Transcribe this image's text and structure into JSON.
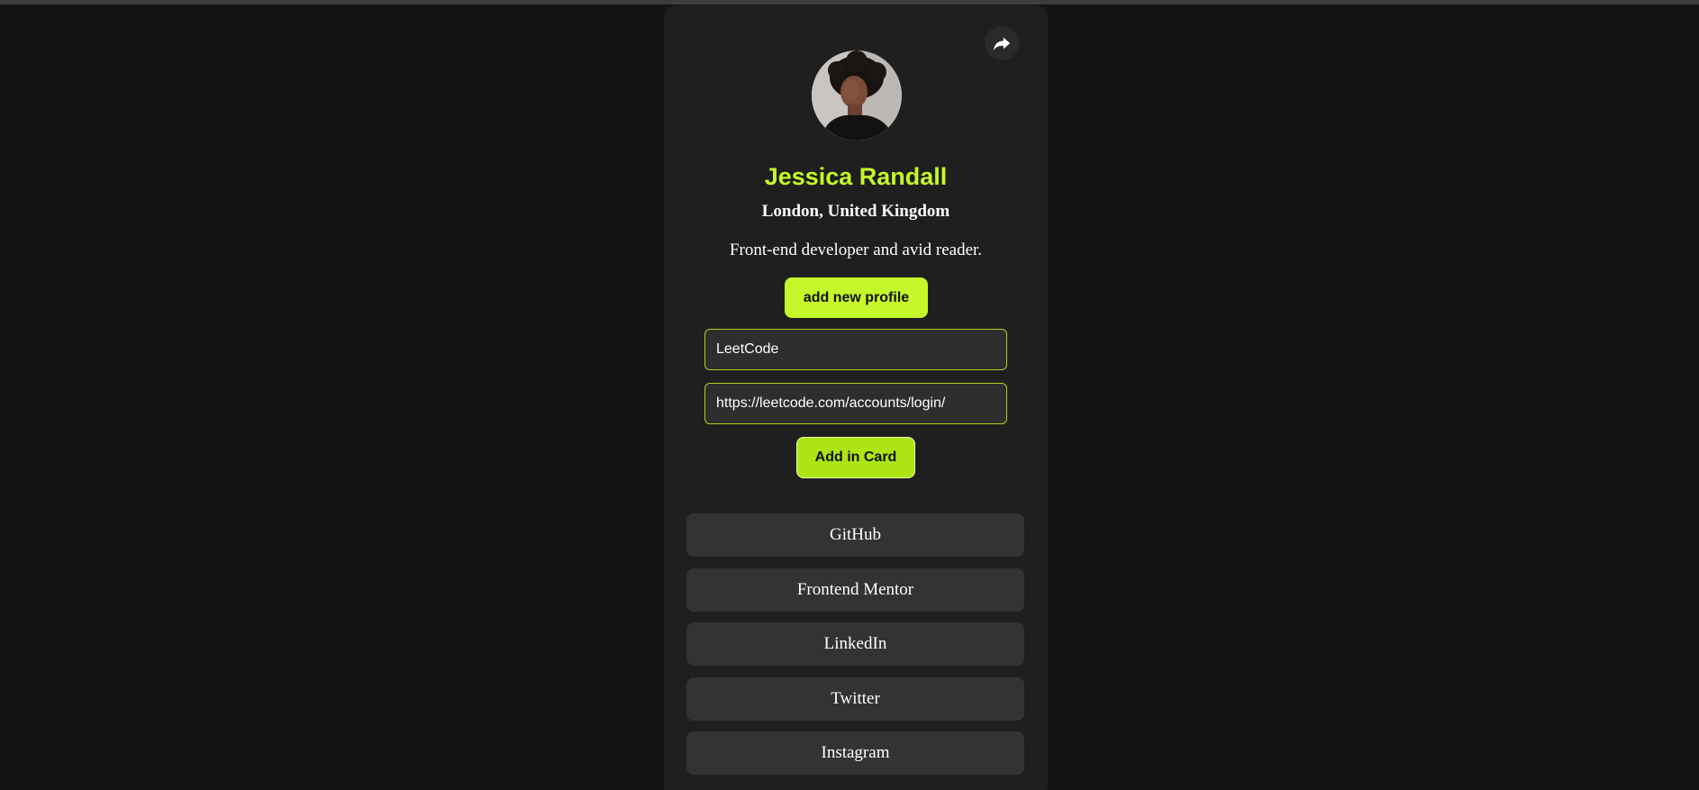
{
  "profile": {
    "name": "Jessica Randall",
    "location": "London, United Kingdom",
    "bio": "Front-end developer and avid reader."
  },
  "actions": {
    "share_icon": "share-icon",
    "add_profile_label": "add new profile",
    "add_card_label": "Add in Card"
  },
  "form": {
    "name_value": "LeetCode",
    "url_value": "https://leetcode.com/accounts/login/"
  },
  "links": [
    {
      "label": "GitHub"
    },
    {
      "label": "Frontend Mentor"
    },
    {
      "label": "LinkedIn"
    },
    {
      "label": "Twitter"
    },
    {
      "label": "Instagram"
    }
  ],
  "colors": {
    "page_bg": "#141414",
    "card_bg": "#1f1f1f",
    "accent": "#c4f82a",
    "link_bg": "#333333"
  }
}
